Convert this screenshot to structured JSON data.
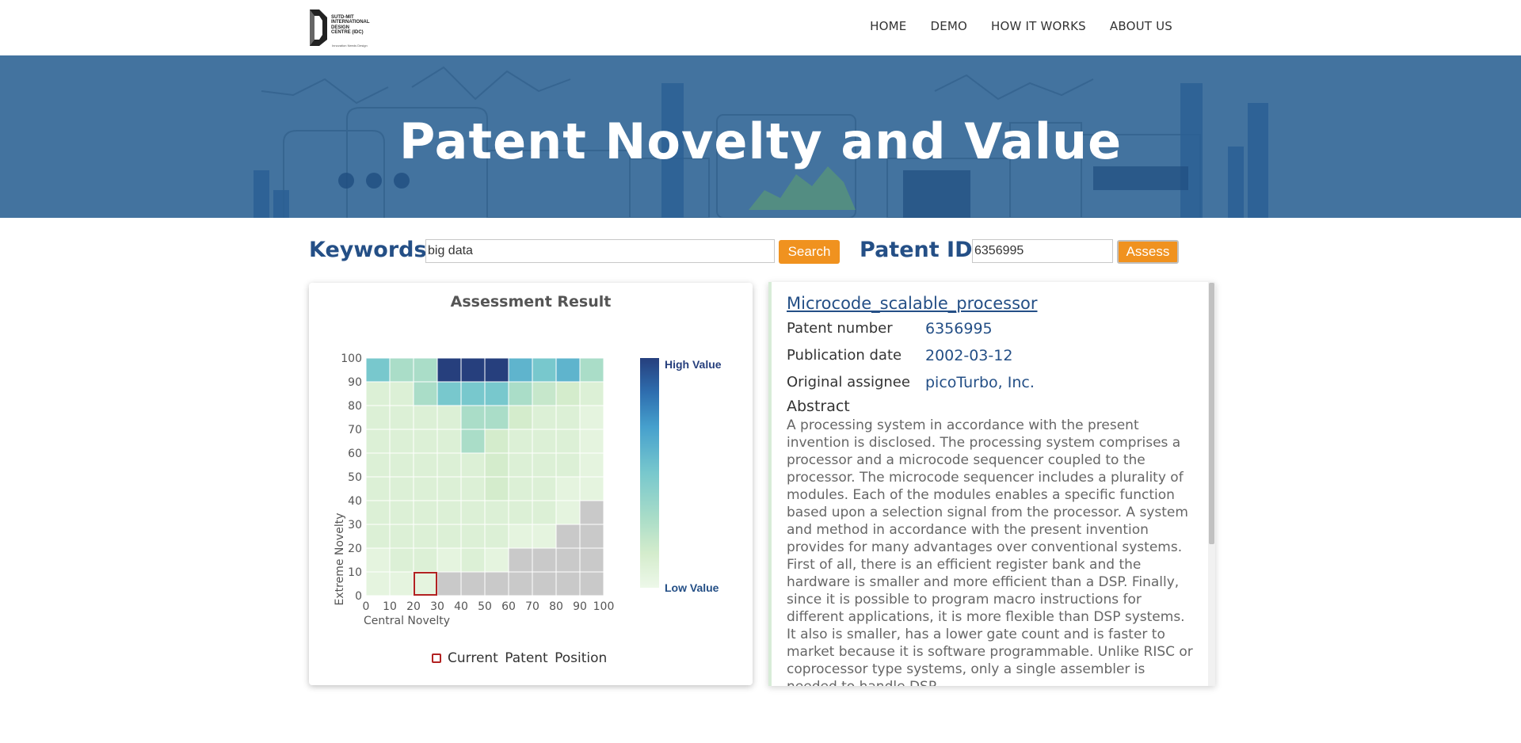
{
  "header": {
    "logo_text": "SUTD-MIT\nINTERNATIONAL\nDESIGN\nCENTRE (IDC)",
    "logo_tagline": "Innovation Needs Design",
    "nav": [
      "HOME",
      "DEMO",
      "HOW IT WORKS",
      "ABOUT US"
    ]
  },
  "hero": {
    "title": "Patent Novelty and Value"
  },
  "search": {
    "keywords_label": "Keywords:",
    "keywords_value": "big data",
    "search_button": "Search",
    "patent_id_label": "Patent ID:",
    "patent_id_value": "6356995",
    "assess_button": "Assess"
  },
  "assessment": {
    "title": "Assessment Result",
    "current_position_label": "Current Patent Position"
  },
  "chart_data": {
    "type": "heatmap",
    "xlabel": "Central Novelty",
    "ylabel": "Extreme Novelty",
    "x_ticks": [
      "0",
      "10",
      "20",
      "30",
      "40",
      "50",
      "60",
      "70",
      "80",
      "90",
      "100"
    ],
    "y_ticks": [
      "0",
      "10",
      "20",
      "30",
      "40",
      "50",
      "60",
      "70",
      "80",
      "90",
      "100"
    ],
    "xlim": [
      0,
      100
    ],
    "ylim": [
      0,
      100
    ],
    "colorbar": {
      "high_label": "High Value",
      "low_label": "Low Value",
      "high_color": "#263f7d",
      "low_color": "#edf8e9"
    },
    "no_data_color": "#c9c9c9",
    "current_position": {
      "x_bin": [
        20,
        30
      ],
      "y_bin": [
        0,
        10
      ],
      "color": "#b22222"
    },
    "rows_top_to_bottom": [
      [
        0.5,
        0.3,
        0.3,
        1.0,
        1.0,
        1.0,
        0.6,
        0.5,
        0.6,
        0.3
      ],
      [
        0.1,
        0.1,
        0.3,
        0.5,
        0.5,
        0.5,
        0.3,
        0.2,
        0.15,
        0.1
      ],
      [
        0.1,
        0.1,
        0.1,
        0.1,
        0.3,
        0.3,
        0.15,
        0.1,
        0.1,
        0.05
      ],
      [
        0.1,
        0.1,
        0.1,
        0.1,
        0.3,
        0.15,
        0.1,
        0.1,
        0.1,
        0.05
      ],
      [
        0.1,
        0.1,
        0.1,
        0.1,
        0.1,
        0.15,
        0.1,
        0.1,
        0.1,
        0.05
      ],
      [
        0.1,
        0.1,
        0.1,
        0.1,
        0.1,
        0.15,
        0.1,
        0.1,
        0.05,
        0.05
      ],
      [
        0.1,
        0.1,
        0.1,
        0.1,
        0.1,
        0.1,
        0.1,
        0.1,
        0.05,
        null
      ],
      [
        0.1,
        0.1,
        0.1,
        0.1,
        0.1,
        0.1,
        0.05,
        0.05,
        null,
        null
      ],
      [
        0.05,
        0.1,
        0.1,
        0.05,
        0.1,
        0.05,
        null,
        null,
        null,
        null
      ],
      [
        0.05,
        0.05,
        0.05,
        null,
        null,
        null,
        null,
        null,
        null,
        null
      ]
    ]
  },
  "patent": {
    "title": "Microcode_scalable_processor",
    "fields": [
      {
        "label": "Patent number",
        "value": "6356995"
      },
      {
        "label": "Publication date",
        "value": "2002-03-12"
      },
      {
        "label": "Original assignee",
        "value": "picoTurbo, Inc."
      }
    ],
    "abstract_heading": "Abstract",
    "abstract": "A processing system in accordance with the present invention is disclosed. The processing system comprises a processor and a microcode sequencer coupled to the processor. The microcode sequencer includes a plurality of modules. Each of the modules enables a specific function based upon a selection signal from the processor. A system and method in accordance with the present invention provides for many advantages over conventional systems. First of all, there is an efficient register bank and the hardware is smaller and more efficient than a DSP. Finally, since it is possible to program macro instructions for different applications, it is more flexible than DSP systems. It also is smaller, has a lower gate count and is faster to market because it is software programmable. Unlike RISC or coprocessor type systems, only a single assembler is needed to handle DSP"
  }
}
